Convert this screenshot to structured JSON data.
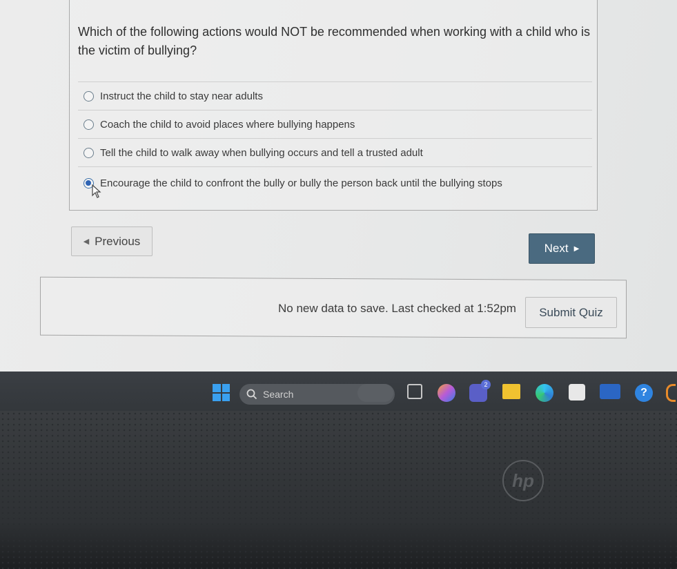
{
  "question": {
    "text": "Which of the following actions would NOT be recommended when working with a child who is the victim of bullying?",
    "options": [
      {
        "label": "Instruct the child to stay near adults",
        "selected": false
      },
      {
        "label": "Coach the child to avoid places where bullying happens",
        "selected": false
      },
      {
        "label": "Tell the child to walk away when bullying occurs and tell a trusted adult",
        "selected": false
      },
      {
        "label": "Encourage the child to confront the bully or bully the person back until the bullying stops",
        "selected": true
      }
    ]
  },
  "nav": {
    "previous_label": "Previous",
    "next_label": "Next"
  },
  "status": {
    "message": "No new data to save. Last checked at 1:52pm",
    "submit_label": "Submit Quiz"
  },
  "taskbar": {
    "search_label": "Search",
    "teams_badge": "2"
  },
  "colors": {
    "next_button": "#4a6a80",
    "radio_selected": "#2f64b4",
    "taskbar": "#373b3f"
  }
}
